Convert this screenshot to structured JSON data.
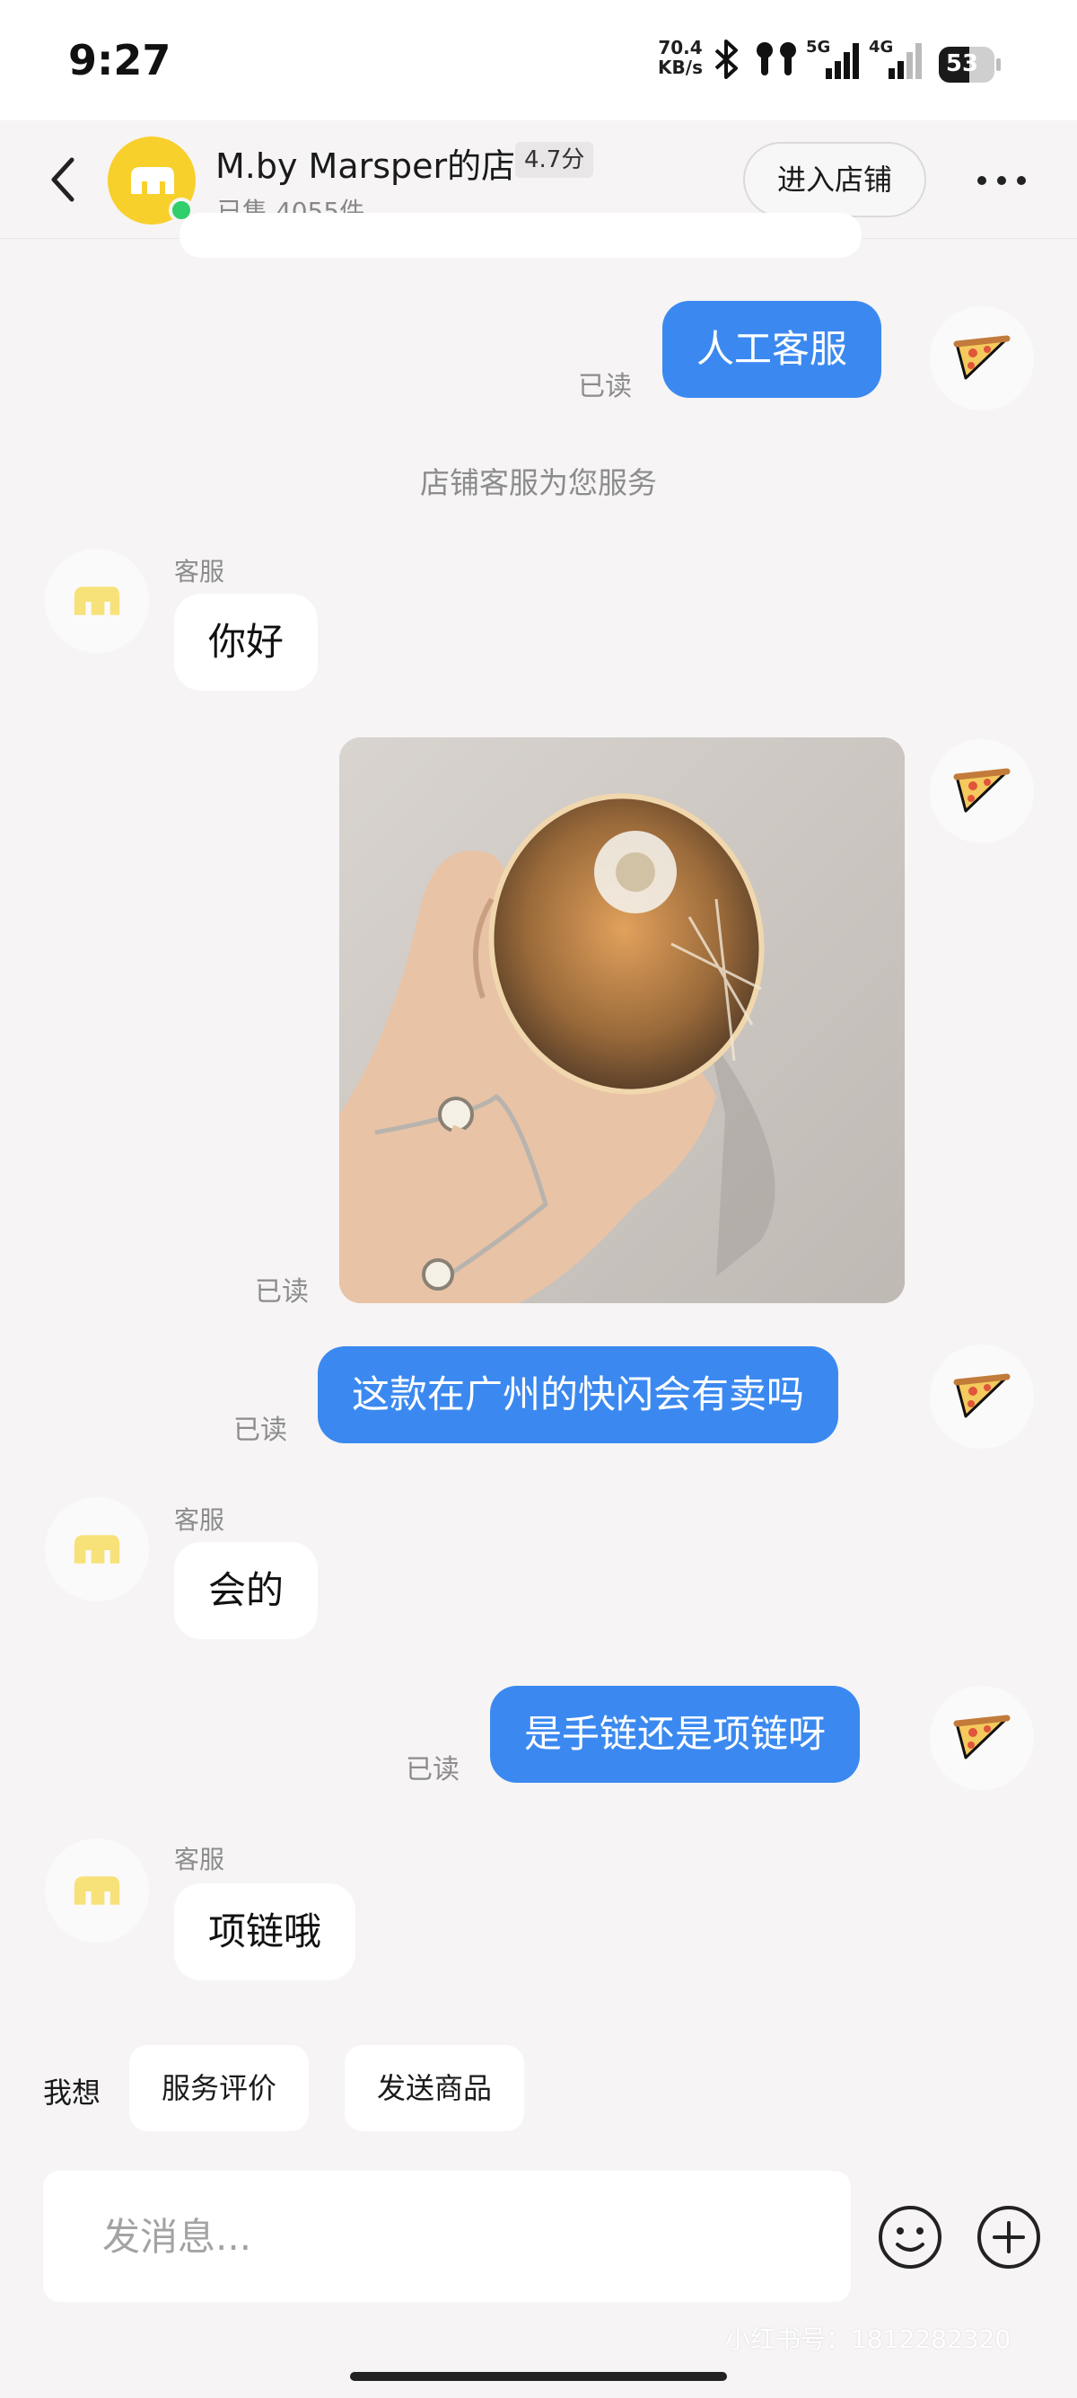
{
  "status_bar": {
    "time": "9:27",
    "net_speed_value": "70.4",
    "net_speed_unit": "KB/s",
    "signal_1_label": "5G",
    "signal_2_label": "4G",
    "battery": "53"
  },
  "header": {
    "shop_name": "M.by Marsper的店",
    "rating": "4.7分",
    "sold": "已售 4055件",
    "enter_shop_label": "进入店铺"
  },
  "chat": {
    "system_notice": "店铺客服为您服务",
    "read_label": "已读",
    "service_label": "客服",
    "messages": [
      {
        "from": "me",
        "text": "人工客服",
        "status": "已读"
      },
      {
        "from": "service",
        "sender": "客服",
        "text": "你好"
      },
      {
        "from": "me",
        "type": "image",
        "status": "已读"
      },
      {
        "from": "me",
        "text": "这款在广州的快闪会有卖吗",
        "status": "已读"
      },
      {
        "from": "service",
        "sender": "客服",
        "text": "会的"
      },
      {
        "from": "me",
        "text": "是手链还是项链呀",
        "status": "已读"
      },
      {
        "from": "service",
        "sender": "客服",
        "text": "项链哦"
      }
    ]
  },
  "quick_actions": {
    "label": "我想",
    "items": [
      "服务评价",
      "发送商品"
    ]
  },
  "composer": {
    "placeholder": "发消息..."
  },
  "watermark": "小红书号：1812282320",
  "colors": {
    "outgoing_bubble": "#3b89f0",
    "incoming_bubble": "#ffffff",
    "shop_avatar": "#f7d02c",
    "online_dot": "#2fcf6c"
  }
}
